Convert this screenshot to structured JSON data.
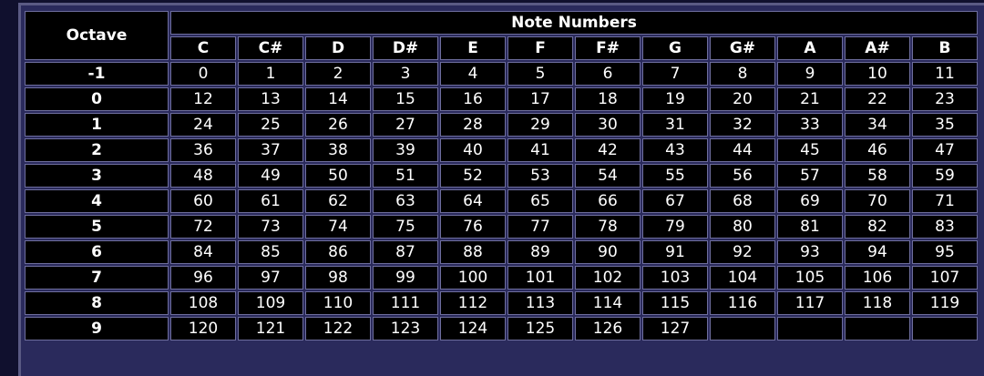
{
  "header": {
    "octave_label": "Octave",
    "note_numbers_label": "Note Numbers"
  },
  "notes": [
    "C",
    "C#",
    "D",
    "D#",
    "E",
    "F",
    "F#",
    "G",
    "G#",
    "A",
    "A#",
    "B"
  ],
  "rows": [
    {
      "octave": "-1",
      "values": [
        "0",
        "1",
        "2",
        "3",
        "4",
        "5",
        "6",
        "7",
        "8",
        "9",
        "10",
        "11"
      ]
    },
    {
      "octave": "0",
      "values": [
        "12",
        "13",
        "14",
        "15",
        "16",
        "17",
        "18",
        "19",
        "20",
        "21",
        "22",
        "23"
      ]
    },
    {
      "octave": "1",
      "values": [
        "24",
        "25",
        "26",
        "27",
        "28",
        "29",
        "30",
        "31",
        "32",
        "33",
        "34",
        "35"
      ]
    },
    {
      "octave": "2",
      "values": [
        "36",
        "37",
        "38",
        "39",
        "40",
        "41",
        "42",
        "43",
        "44",
        "45",
        "46",
        "47"
      ]
    },
    {
      "octave": "3",
      "values": [
        "48",
        "49",
        "50",
        "51",
        "52",
        "53",
        "54",
        "55",
        "56",
        "57",
        "58",
        "59"
      ]
    },
    {
      "octave": "4",
      "values": [
        "60",
        "61",
        "62",
        "63",
        "64",
        "65",
        "66",
        "67",
        "68",
        "69",
        "70",
        "71"
      ]
    },
    {
      "octave": "5",
      "values": [
        "72",
        "73",
        "74",
        "75",
        "76",
        "77",
        "78",
        "79",
        "80",
        "81",
        "82",
        "83"
      ]
    },
    {
      "octave": "6",
      "values": [
        "84",
        "85",
        "86",
        "87",
        "88",
        "89",
        "90",
        "91",
        "92",
        "93",
        "94",
        "95"
      ]
    },
    {
      "octave": "7",
      "values": [
        "96",
        "97",
        "98",
        "99",
        "100",
        "101",
        "102",
        "103",
        "104",
        "105",
        "106",
        "107"
      ]
    },
    {
      "octave": "8",
      "values": [
        "108",
        "109",
        "110",
        "111",
        "112",
        "113",
        "114",
        "115",
        "116",
        "117",
        "118",
        "119"
      ]
    },
    {
      "octave": "9",
      "values": [
        "120",
        "121",
        "122",
        "123",
        "124",
        "125",
        "126",
        "127"
      ]
    }
  ]
}
